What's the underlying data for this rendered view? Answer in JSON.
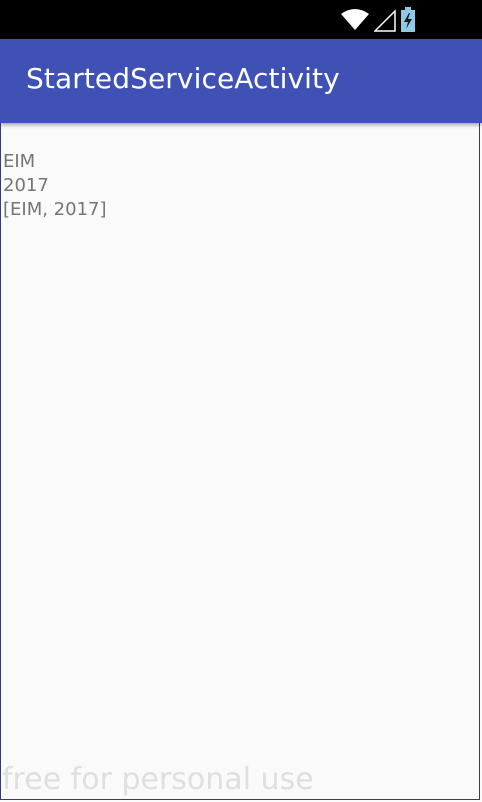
{
  "status_bar": {
    "icons": [
      "wifi-icon",
      "cell-signal-icon",
      "battery-charging-icon"
    ]
  },
  "app_bar": {
    "title": "StartedServiceActivity",
    "color": "#3f51b5"
  },
  "content": {
    "lines": [
      "EIM",
      "2017",
      "[EIM, 2017]"
    ]
  },
  "watermark": {
    "text": "free for personal use"
  }
}
